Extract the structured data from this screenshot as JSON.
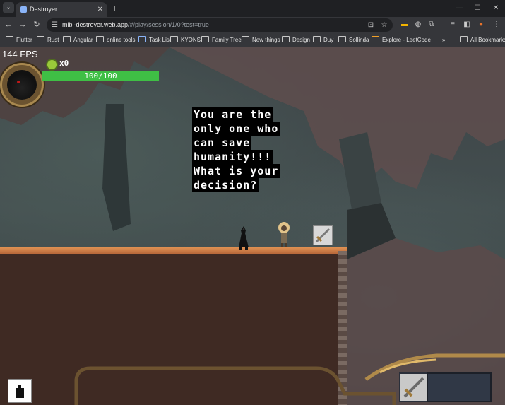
{
  "browser": {
    "tab_title": "Destroyer",
    "tab_close": "✕",
    "new_tab": "+",
    "url_host": "mibi-destroyer.web.app",
    "url_path": "/#/play/session/1/0?test=true",
    "window_min": "—",
    "window_max": "☐",
    "window_close": "✕",
    "bookmarks": [
      "Flutter",
      "Rust",
      "Angular",
      "online tools",
      "Task List",
      "KYONS",
      "Family Tree",
      "New things",
      "Design",
      "Duy",
      "Sollinda",
      "Explore - LeetCode"
    ],
    "bookmarks_more": "»",
    "all_bookmarks": "All Bookmarks"
  },
  "game": {
    "fps": "144 FPS",
    "coins": "x0",
    "health": "100/100",
    "health_fraction": 1.0,
    "dialog_lines": [
      "You are the",
      "only one who",
      "can save",
      "humanity!!!",
      "What is your",
      "decision?"
    ],
    "colors": {
      "health_fill": "#3fbf45",
      "ground_top": "#e49655",
      "ground_dirt": "#3f2a23",
      "cave_rock": "#5f4e4d"
    }
  }
}
